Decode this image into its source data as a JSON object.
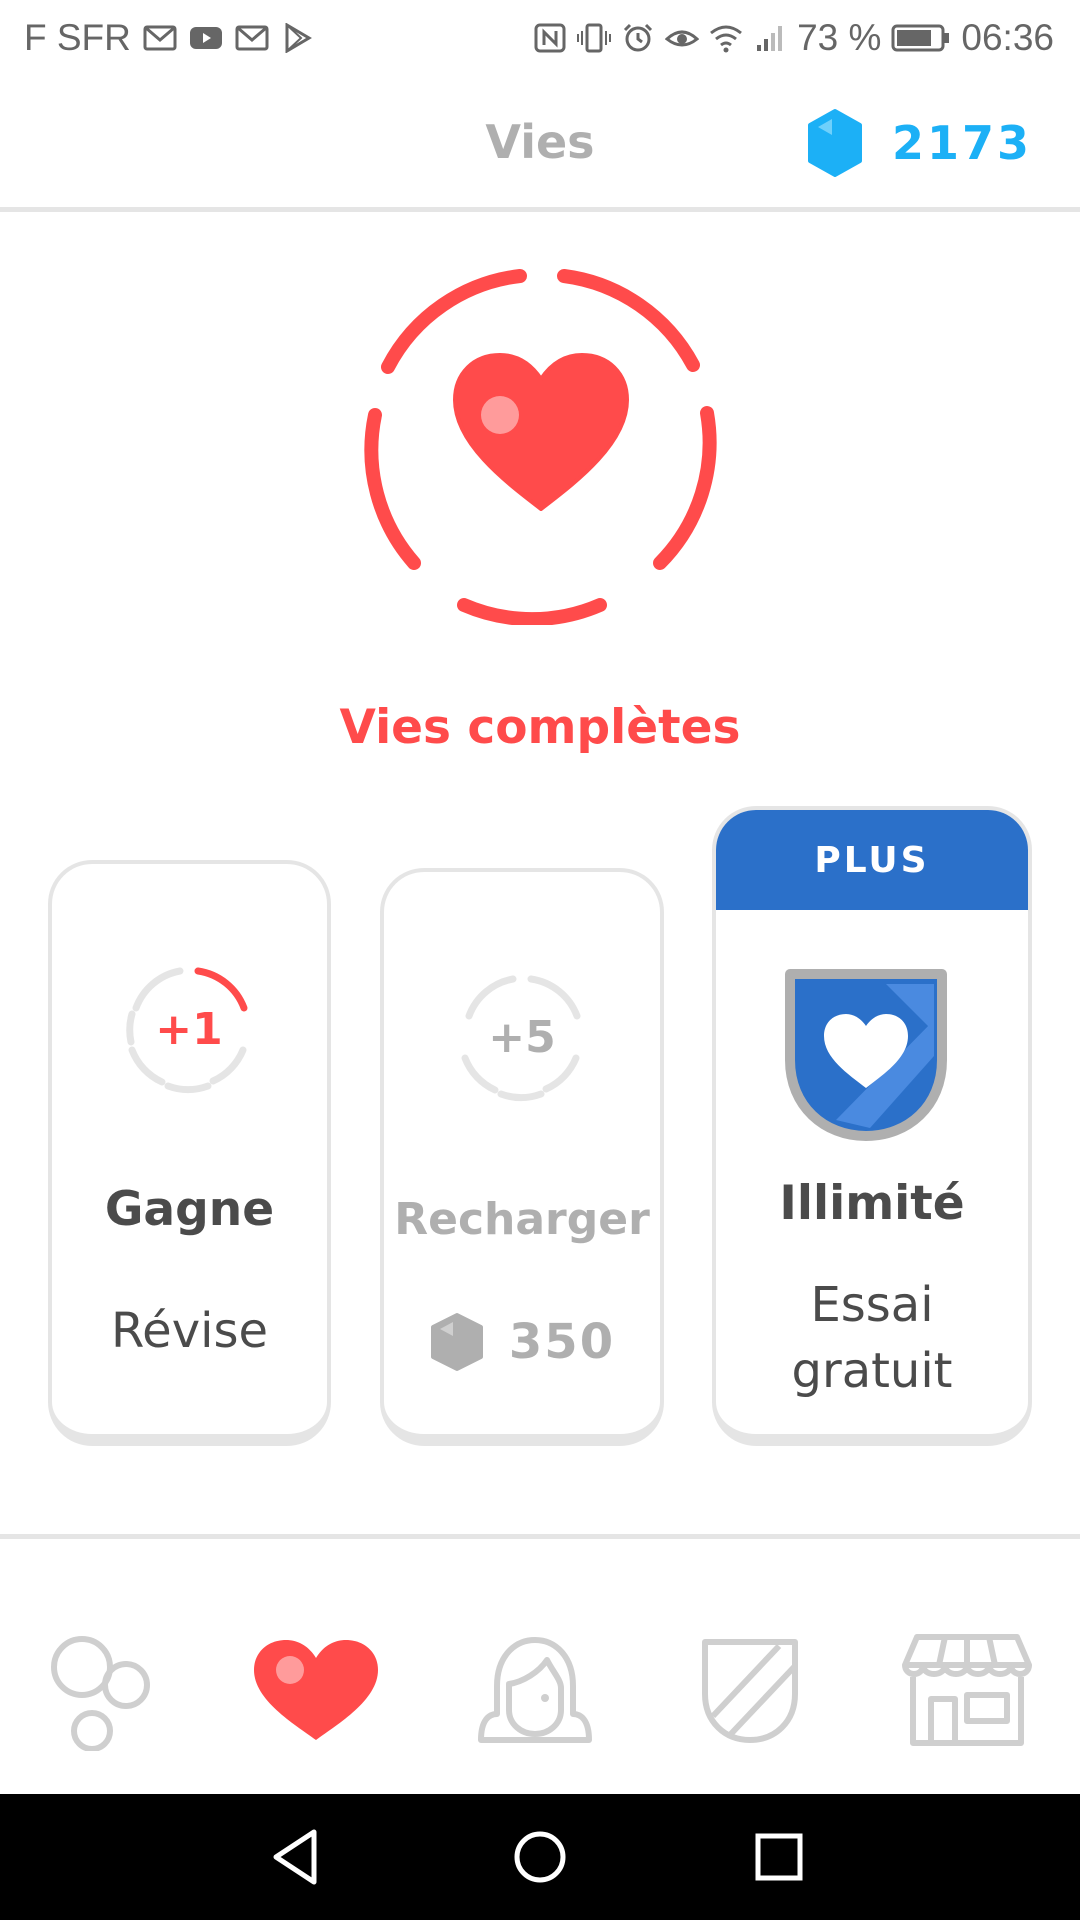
{
  "status_bar": {
    "carrier": "F SFR",
    "battery": "73 %",
    "time": "06:36",
    "left_icons": [
      "gmail-icon",
      "youtube-icon",
      "gmail-icon",
      "play-store-icon"
    ],
    "right_icons": [
      "nfc-icon",
      "vibrate-icon",
      "alarm-icon",
      "eye-comfort-icon",
      "wifi-icon",
      "signal-icon",
      "battery-icon"
    ]
  },
  "header": {
    "title": "Vies",
    "gems_count": "2173",
    "gem_icon": "gem-icon"
  },
  "hero": {
    "icon": "heart-icon",
    "status": "Vies complètes"
  },
  "cards": {
    "refill_earn": {
      "badge": "+1",
      "title": "Gagne",
      "subtitle": "Révise"
    },
    "refill_gems": {
      "badge": "+5",
      "title": "Recharger",
      "price": "350"
    },
    "unlimited": {
      "banner": "PLUS",
      "title": "Illimité",
      "subtitle_line1": "Essai",
      "subtitle_line2": "gratuit"
    }
  },
  "tabs": [
    {
      "icon": "learn-circles-icon",
      "active": false
    },
    {
      "icon": "heart-icon",
      "active": true
    },
    {
      "icon": "profile-icon",
      "active": false
    },
    {
      "icon": "league-shield-icon",
      "active": false
    },
    {
      "icon": "shop-icon",
      "active": false
    }
  ],
  "android_nav": [
    "back-icon",
    "home-icon",
    "recents-icon"
  ],
  "colors": {
    "accent_red": "#ff4b4b",
    "gem_blue": "#1cb0f6",
    "plus_blue": "#2b70c9",
    "muted_gray": "#afafaf",
    "border_gray": "#e5e5e5"
  }
}
